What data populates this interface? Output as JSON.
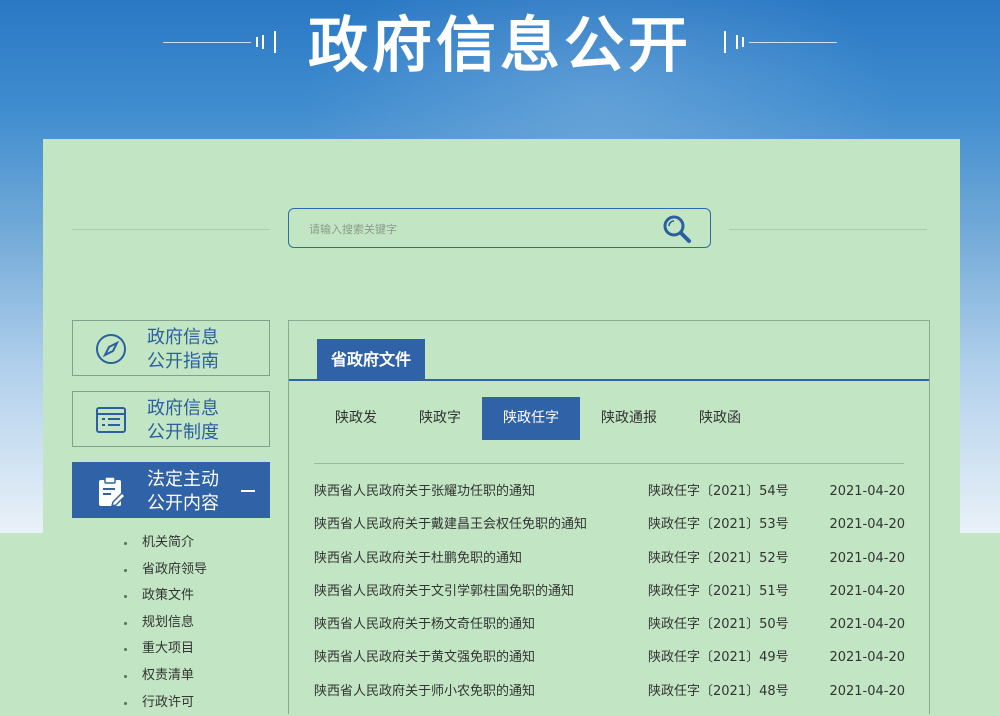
{
  "header": {
    "title": "政府信息公开"
  },
  "search": {
    "placeholder": "请输入搜索关键字"
  },
  "sidebar": {
    "items": [
      {
        "line1": "政府信息",
        "line2": "公开指南"
      },
      {
        "line1": "政府信息",
        "line2": "公开制度"
      },
      {
        "line1": "法定主动",
        "line2": "公开内容",
        "toggle": "—"
      }
    ],
    "sub_items": [
      "机关简介",
      "省政府领导",
      "政策文件",
      "规划信息",
      "重大项目",
      "权责清单",
      "行政许可"
    ]
  },
  "content": {
    "section_title": "省政府文件",
    "tabs": [
      "陕政发",
      "陕政字",
      "陕政任字",
      "陕政通报",
      "陕政函"
    ],
    "active_tab": "陕政任字",
    "rows": [
      {
        "title": "陕西省人民政府关于张耀功任职的通知",
        "number": "陕政任字〔2021〕54号",
        "date": "2021-04-20"
      },
      {
        "title": "陕西省人民政府关于戴建昌王会权任免职的通知",
        "number": "陕政任字〔2021〕53号",
        "date": "2021-04-20"
      },
      {
        "title": "陕西省人民政府关于杜鹏免职的通知",
        "number": "陕政任字〔2021〕52号",
        "date": "2021-04-20"
      },
      {
        "title": "陕西省人民政府关于文引学郭柱国免职的通知",
        "number": "陕政任字〔2021〕51号",
        "date": "2021-04-20"
      },
      {
        "title": "陕西省人民政府关于杨文奇任职的通知",
        "number": "陕政任字〔2021〕50号",
        "date": "2021-04-20"
      },
      {
        "title": "陕西省人民政府关于黄文强免职的通知",
        "number": "陕政任字〔2021〕49号",
        "date": "2021-04-20"
      },
      {
        "title": "陕西省人民政府关于师小农免职的通知",
        "number": "陕政任字〔2021〕48号",
        "date": "2021-04-20"
      }
    ]
  },
  "colors": {
    "primary_blue": "#2f62a6",
    "panel_green": "#c2e6c4"
  }
}
